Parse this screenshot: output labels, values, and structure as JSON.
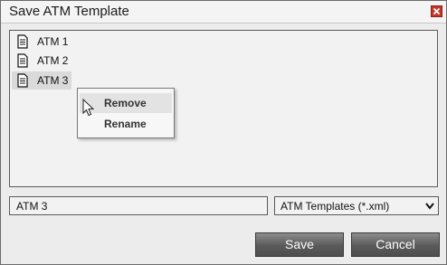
{
  "window": {
    "title": "Save ATM Template"
  },
  "templates": {
    "items": [
      {
        "label": "ATM 1",
        "icon": "document-icon",
        "selected": false
      },
      {
        "label": "ATM 2",
        "icon": "document-icon",
        "selected": false
      },
      {
        "label": "ATM 3",
        "icon": "document-icon",
        "selected": true
      }
    ]
  },
  "context_menu": {
    "items": [
      {
        "label": "Remove",
        "hovered": true
      },
      {
        "label": "Rename",
        "hovered": false
      }
    ]
  },
  "filename": {
    "value": "ATM 3"
  },
  "filetype": {
    "selected": "ATM Templates (*.xml)"
  },
  "buttons": {
    "save": "Save",
    "cancel": "Cancel"
  },
  "colors": {
    "close_button": "#c0392b",
    "button_dark": "#5a5a5a"
  }
}
